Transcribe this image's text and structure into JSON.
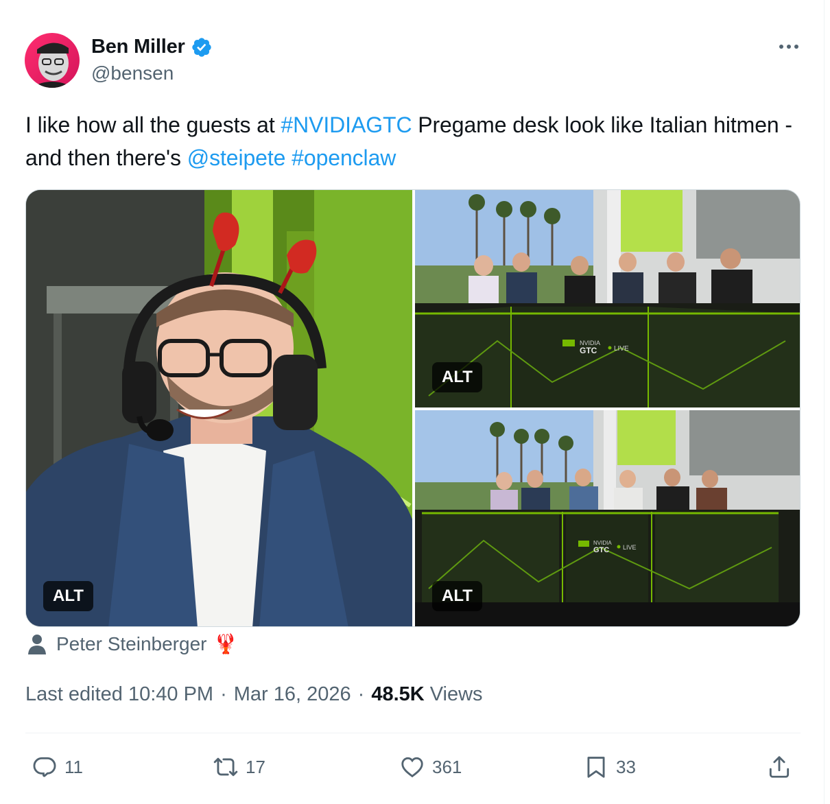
{
  "author": {
    "display_name": "Ben Miller",
    "handle": "@bensen",
    "verified": true
  },
  "tweet": {
    "text_parts": [
      {
        "type": "text",
        "value": "I like how all the guests at "
      },
      {
        "type": "link",
        "value": "#NVIDIAGTC"
      },
      {
        "type": "text",
        "value": " Pregame desk look like Italian hitmen - and then there's "
      },
      {
        "type": "link",
        "value": "@steipete"
      },
      {
        "type": "text",
        "value": " "
      },
      {
        "type": "link",
        "value": "#openclaw"
      }
    ]
  },
  "media": {
    "alt_label": "ALT",
    "images": [
      {
        "id": "left",
        "alt_label": "ALT"
      },
      {
        "id": "top-right",
        "alt_label": "ALT"
      },
      {
        "id": "bottom-right",
        "alt_label": "ALT"
      }
    ],
    "desk_logo_text": "GTC",
    "desk_logo_sub": "NVIDIA",
    "desk_live_text": "LIVE"
  },
  "tagged": {
    "name": "Peter Steinberger",
    "emoji": "🦞"
  },
  "meta": {
    "edited_label": "Last edited 10:40 PM",
    "separator": "·",
    "date": "Mar 16, 2026",
    "views_count": "48.5K",
    "views_label": "Views"
  },
  "actions": {
    "replies": "11",
    "reposts": "17",
    "likes": "361",
    "bookmarks": "33"
  },
  "colors": {
    "link": "#1d9bf0",
    "secondary_text": "#536471",
    "primary_text": "#0f1419",
    "verified": "#1d9bf0",
    "nvidia_green": "#76b900"
  }
}
